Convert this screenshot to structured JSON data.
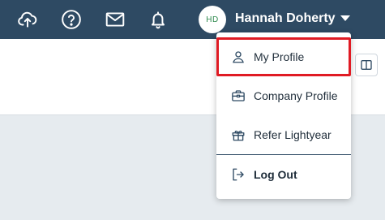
{
  "header": {
    "icons": [
      "cloud-upload-icon",
      "help-icon",
      "mail-icon",
      "bell-icon"
    ],
    "avatar_initials": "HD",
    "user_name": "Hannah Doherty"
  },
  "user_menu": {
    "items": [
      {
        "label": "My Profile",
        "icon": "person-icon"
      },
      {
        "label": "Company Profile",
        "icon": "briefcase-icon"
      },
      {
        "label": "Refer Lightyear",
        "icon": "gift-icon"
      },
      {
        "label": "Log Out",
        "icon": "logout-icon"
      }
    ]
  },
  "colors": {
    "header_bg": "#2e4a63",
    "highlight": "#e01b24",
    "content_bg": "#e6ebef",
    "avatar_text": "#2f8a4e"
  }
}
